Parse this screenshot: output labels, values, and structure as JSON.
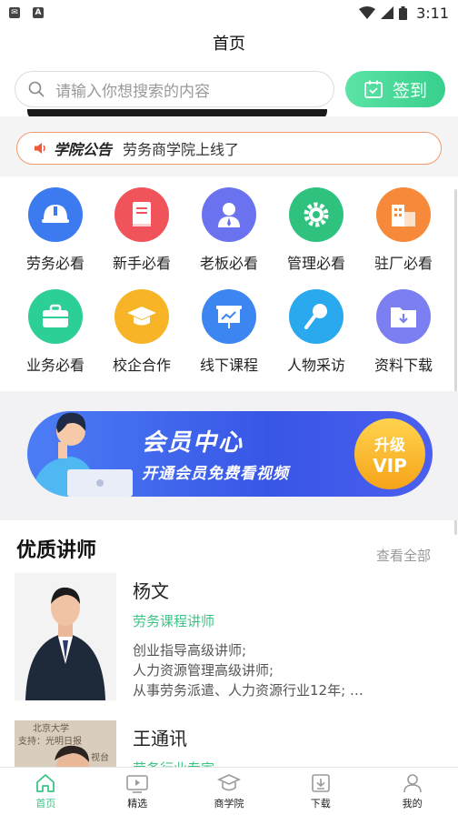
{
  "status_bar": {
    "time": "3:11",
    "icons": [
      "mail-icon",
      "a-icon",
      "wifi-icon",
      "signal-icon",
      "battery-icon"
    ]
  },
  "header": {
    "title": "首页"
  },
  "search": {
    "placeholder": "请输入你想搜索的内容"
  },
  "checkin": {
    "label": "签到"
  },
  "notice": {
    "label": "学院公告",
    "text": "劳务商学院上线了"
  },
  "categories": [
    {
      "label": "劳务必看",
      "color": "#3c7bef",
      "icon": "helmet-icon"
    },
    {
      "label": "新手必看",
      "color": "#f0545a",
      "icon": "book-icon"
    },
    {
      "label": "老板必看",
      "color": "#6b72f0",
      "icon": "boss-icon"
    },
    {
      "label": "管理必看",
      "color": "#2ec27e",
      "icon": "gear-icon"
    },
    {
      "label": "驻厂必看",
      "color": "#f7893a",
      "icon": "building-icon"
    },
    {
      "label": "业务必看",
      "color": "#2ccf95",
      "icon": "briefcase-icon"
    },
    {
      "label": "校企合作",
      "color": "#f7b426",
      "icon": "graduation-cap-icon"
    },
    {
      "label": "线下课程",
      "color": "#3b86f0",
      "icon": "presentation-icon"
    },
    {
      "label": "人物采访",
      "color": "#2aa9ee",
      "icon": "microphone-icon"
    },
    {
      "label": "资料下载",
      "color": "#7b7ff2",
      "icon": "folder-download-icon"
    }
  ],
  "vip": {
    "title": "会员中心",
    "subtitle": "开通会员免费看视频",
    "button_line1": "升级",
    "button_line2": "VIP"
  },
  "teachers_section": {
    "title": "优质讲师",
    "view_all": "查看全部"
  },
  "teachers": [
    {
      "name": "杨文",
      "role": "劳务课程讲师",
      "desc": [
        "创业指导高级讲师;",
        "人力资源管理高级讲师;",
        "从事劳务派遣、人力资源行业12年; …"
      ]
    },
    {
      "name": "王通讯",
      "role": "劳务行业专家",
      "desc": [],
      "photo_text": [
        "北京大学",
        "支持：光明日报",
        "视台"
      ]
    }
  ],
  "tabbar": [
    {
      "label": "首页",
      "icon": "home-icon",
      "active": true
    },
    {
      "label": "精选",
      "icon": "video-icon",
      "active": false
    },
    {
      "label": "商学院",
      "icon": "academy-icon",
      "active": false
    },
    {
      "label": "下载",
      "icon": "download-icon",
      "active": false
    },
    {
      "label": "我的",
      "icon": "user-icon",
      "active": false
    }
  ]
}
